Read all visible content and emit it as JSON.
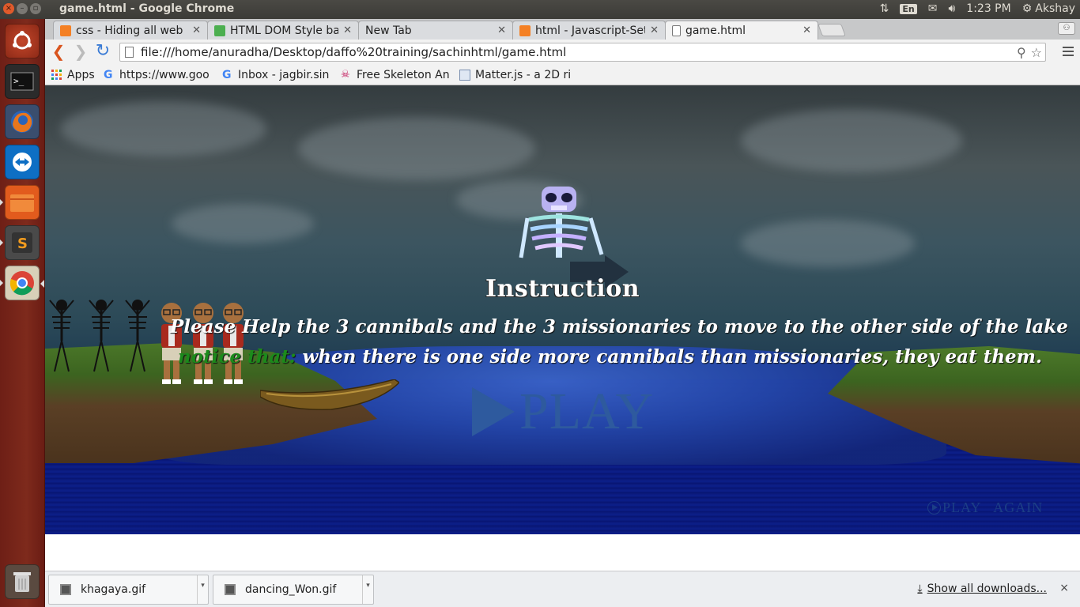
{
  "window": {
    "title": "game.html - Google Chrome"
  },
  "system_tray": {
    "keyboard_layout": "En",
    "time": "1:23 PM",
    "user": "Akshay"
  },
  "launcher": {
    "items": [
      {
        "name": "ubuntu-dash-icon"
      },
      {
        "name": "terminal-icon"
      },
      {
        "name": "firefox-icon"
      },
      {
        "name": "teamviewer-icon"
      },
      {
        "name": "files-icon"
      },
      {
        "name": "sublime-text-icon"
      },
      {
        "name": "chrome-icon"
      },
      {
        "name": "trash-icon"
      }
    ]
  },
  "tabs": [
    {
      "label": "css - Hiding all web p",
      "active": false
    },
    {
      "label": "HTML DOM Style bac",
      "active": false
    },
    {
      "label": "New Tab",
      "active": false
    },
    {
      "label": "html - Javascript-Set",
      "active": false
    },
    {
      "label": "game.html",
      "active": true
    }
  ],
  "address_bar": {
    "url": "file:///home/anuradha/Desktop/daffo%20training/sachinhtml/game.html"
  },
  "bookmarks": [
    {
      "label": "Apps",
      "icon": "apps-grid-icon"
    },
    {
      "label": "https://www.goo",
      "icon": "google-icon"
    },
    {
      "label": "Inbox - jagbir.sin",
      "icon": "google-icon"
    },
    {
      "label": "Free Skeleton An",
      "icon": "skeleton-icon"
    },
    {
      "label": "Matter.js - a 2D ri",
      "icon": "matterjs-icon"
    }
  ],
  "game": {
    "instruction_title": "Instruction",
    "line1": "Please Help the 3 cannibals and the 3 missionaries to move to the other side of the lake",
    "notice_label": "notice that:",
    "line2": " when there is one side more cannibals than missionaries, they eat them.",
    "play_label": "PLAY",
    "play_again_label": "PLAY   AGAIN",
    "colors": {
      "notice": "#1b8a1b",
      "play": "#2e5a9e",
      "play_again": "#1c3e86"
    }
  },
  "downloads": {
    "items": [
      {
        "label": "khagaya.gif"
      },
      {
        "label": "dancing_Won.gif"
      }
    ],
    "show_all_label": "Show all downloads...",
    "close_label": "×"
  }
}
